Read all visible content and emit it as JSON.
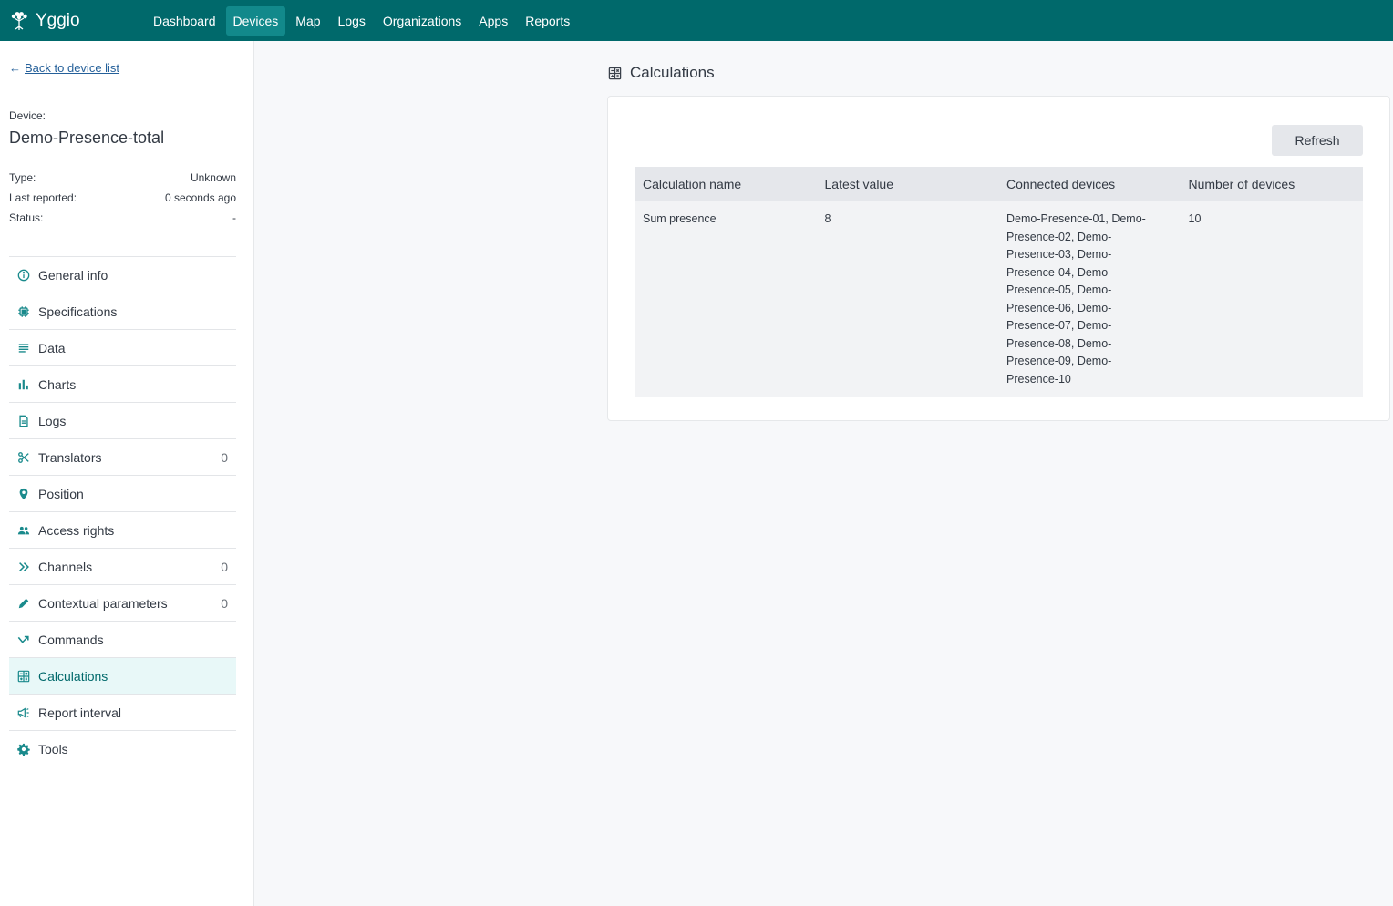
{
  "app": {
    "name": "Yggio",
    "logo_icon": "tree-icon"
  },
  "nav": {
    "items": [
      {
        "label": "Dashboard",
        "active": false
      },
      {
        "label": "Devices",
        "active": true
      },
      {
        "label": "Map",
        "active": false
      },
      {
        "label": "Logs",
        "active": false
      },
      {
        "label": "Organizations",
        "active": false
      },
      {
        "label": "Apps",
        "active": false
      },
      {
        "label": "Reports",
        "active": false
      }
    ]
  },
  "sidebar": {
    "back_link": {
      "icon": "arrow-left-icon",
      "label": "Back to device list"
    },
    "device_label": "Device:",
    "device_name": "Demo-Presence-total",
    "info": [
      {
        "label": "Type:",
        "value": "Unknown"
      },
      {
        "label": "Last reported:",
        "value": "0 seconds ago"
      },
      {
        "label": "Status:",
        "value": "-"
      }
    ],
    "menu": [
      {
        "label": "General info",
        "icon": "info-icon",
        "count": null
      },
      {
        "label": "Specifications",
        "icon": "chip-icon",
        "count": null
      },
      {
        "label": "Data",
        "icon": "lines-icon",
        "count": null
      },
      {
        "label": "Charts",
        "icon": "bar-chart-icon",
        "count": null
      },
      {
        "label": "Logs",
        "icon": "document-icon",
        "count": null
      },
      {
        "label": "Translators",
        "icon": "scissors-icon",
        "count": "0"
      },
      {
        "label": "Position",
        "icon": "map-pin-icon",
        "count": null
      },
      {
        "label": "Access rights",
        "icon": "users-icon",
        "count": null
      },
      {
        "label": "Channels",
        "icon": "double-chevron-right-icon",
        "count": "0"
      },
      {
        "label": "Contextual parameters",
        "icon": "pencil-icon",
        "count": "0"
      },
      {
        "label": "Commands",
        "icon": "command-arrow-icon",
        "count": null
      },
      {
        "label": "Calculations",
        "icon": "calculator-icon",
        "count": null,
        "active": true
      },
      {
        "label": "Report interval",
        "icon": "megaphone-icon",
        "count": null
      },
      {
        "label": "Tools",
        "icon": "gear-icon",
        "count": null
      }
    ]
  },
  "main": {
    "title": "Calculations",
    "title_icon": "calculator-icon",
    "refresh_label": "Refresh",
    "table": {
      "headers": [
        "Calculation name",
        "Latest value",
        "Connected devices",
        "Number of devices"
      ],
      "rows": [
        {
          "name": "Sum presence",
          "latest_value": "8",
          "connected_devices": "Demo-Presence-01, Demo-Presence-02, Demo-Presence-03, Demo-Presence-04, Demo-Presence-05, Demo-Presence-06, Demo-Presence-07, Demo-Presence-08, Demo-Presence-09, Demo-Presence-10",
          "number_of_devices": "10"
        }
      ]
    }
  },
  "colors": {
    "topbar": "#00696b",
    "nav_active": "#12898b",
    "accent": "#1a8a8c",
    "link": "#25609a",
    "sidebar_active_bg": "#e8f8f8"
  }
}
